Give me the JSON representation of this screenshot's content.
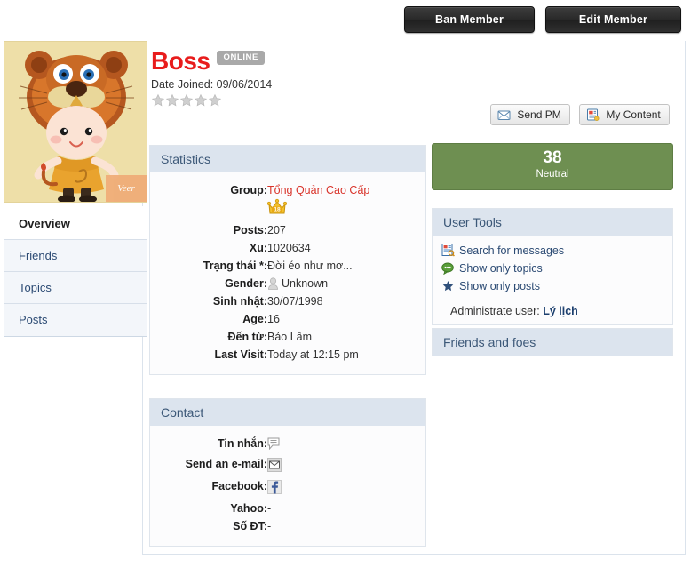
{
  "top_actions": {
    "ban_label": "Ban Member",
    "edit_label": "Edit Member"
  },
  "profile": {
    "username": "Boss",
    "status_badge": "ONLINE",
    "date_joined_label": "Date Joined: 09/06/2014",
    "star_rating": 0,
    "star_total": 5,
    "avatar_alt": "lion-costume-child-avatar",
    "avatar_watermark": "Veer"
  },
  "pm_buttons": {
    "send_pm_label": "Send PM",
    "send_pm_icon": "envelope-icon",
    "my_content_label": "My Content",
    "my_content_icon": "document-icon"
  },
  "tabs": [
    {
      "label": "Overview",
      "active": true
    },
    {
      "label": "Friends",
      "active": false
    },
    {
      "label": "Topics",
      "active": false
    },
    {
      "label": "Posts",
      "active": false
    }
  ],
  "statistics": {
    "title": "Statistics",
    "rows": [
      {
        "key": "Group:",
        "value": "Tổng Quản Cao Cấp",
        "is_link": true,
        "badge": "18"
      },
      {
        "key": "Posts:",
        "value": "207"
      },
      {
        "key": "Xu:",
        "value": "1020634"
      },
      {
        "key": "Trạng thái *:",
        "value": "Đời éo như mơ..."
      },
      {
        "key": "Gender:",
        "value": "Unknown",
        "icon": "person-icon"
      },
      {
        "key": "Sinh nhật:",
        "value": "30/07/1998"
      },
      {
        "key": "Age:",
        "value": "16"
      },
      {
        "key": "Đến từ:",
        "value": "Bảo Lâm"
      },
      {
        "key": "Last Visit:",
        "value": "Today at 12:15 pm"
      }
    ]
  },
  "contact": {
    "title": "Contact",
    "rows": [
      {
        "key": "Tin nhắn:",
        "value": "",
        "icon": "speech-bubble-icon"
      },
      {
        "key": "Send an e-mail:",
        "value": "",
        "icon": "mail-icon"
      },
      {
        "key": "Facebook:",
        "value": "",
        "icon": "facebook-icon"
      },
      {
        "key": "Yahoo:",
        "value": "-"
      },
      {
        "key": "Số ĐT:",
        "value": "-"
      }
    ]
  },
  "reputation": {
    "score": "38",
    "label": "Neutral",
    "color": "#6e8f51"
  },
  "user_tools": {
    "title": "User Tools",
    "items": [
      {
        "label": "Search for messages",
        "icon": "search-document-icon"
      },
      {
        "label": "Show only topics",
        "icon": "comment-icon"
      },
      {
        "label": "Show only posts",
        "icon": "star-icon"
      }
    ],
    "administrate_prefix": "Administrate user:",
    "administrate_link": "Lý lịch"
  },
  "friends_and_foes": {
    "title": "Friends and foes"
  },
  "colors": {
    "accent_red": "#e81c1c",
    "panel_header": "#dce4ee",
    "link_blue": "#2b4a73",
    "reputation_green": "#6e8f51",
    "badge_gray": "#a9a9a9"
  }
}
